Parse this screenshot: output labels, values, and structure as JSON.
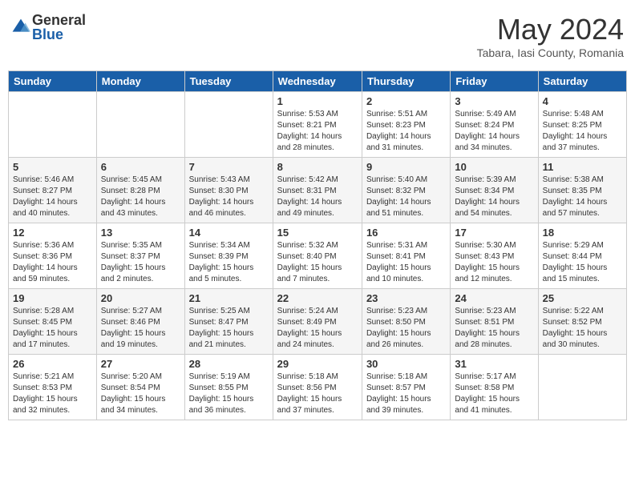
{
  "header": {
    "logo_general": "General",
    "logo_blue": "Blue",
    "month": "May 2024",
    "location": "Tabara, Iasi County, Romania"
  },
  "weekdays": [
    "Sunday",
    "Monday",
    "Tuesday",
    "Wednesday",
    "Thursday",
    "Friday",
    "Saturday"
  ],
  "weeks": [
    [
      {
        "day": "",
        "info": ""
      },
      {
        "day": "",
        "info": ""
      },
      {
        "day": "",
        "info": ""
      },
      {
        "day": "1",
        "info": "Sunrise: 5:53 AM\nSunset: 8:21 PM\nDaylight: 14 hours\nand 28 minutes."
      },
      {
        "day": "2",
        "info": "Sunrise: 5:51 AM\nSunset: 8:23 PM\nDaylight: 14 hours\nand 31 minutes."
      },
      {
        "day": "3",
        "info": "Sunrise: 5:49 AM\nSunset: 8:24 PM\nDaylight: 14 hours\nand 34 minutes."
      },
      {
        "day": "4",
        "info": "Sunrise: 5:48 AM\nSunset: 8:25 PM\nDaylight: 14 hours\nand 37 minutes."
      }
    ],
    [
      {
        "day": "5",
        "info": "Sunrise: 5:46 AM\nSunset: 8:27 PM\nDaylight: 14 hours\nand 40 minutes."
      },
      {
        "day": "6",
        "info": "Sunrise: 5:45 AM\nSunset: 8:28 PM\nDaylight: 14 hours\nand 43 minutes."
      },
      {
        "day": "7",
        "info": "Sunrise: 5:43 AM\nSunset: 8:30 PM\nDaylight: 14 hours\nand 46 minutes."
      },
      {
        "day": "8",
        "info": "Sunrise: 5:42 AM\nSunset: 8:31 PM\nDaylight: 14 hours\nand 49 minutes."
      },
      {
        "day": "9",
        "info": "Sunrise: 5:40 AM\nSunset: 8:32 PM\nDaylight: 14 hours\nand 51 minutes."
      },
      {
        "day": "10",
        "info": "Sunrise: 5:39 AM\nSunset: 8:34 PM\nDaylight: 14 hours\nand 54 minutes."
      },
      {
        "day": "11",
        "info": "Sunrise: 5:38 AM\nSunset: 8:35 PM\nDaylight: 14 hours\nand 57 minutes."
      }
    ],
    [
      {
        "day": "12",
        "info": "Sunrise: 5:36 AM\nSunset: 8:36 PM\nDaylight: 14 hours\nand 59 minutes."
      },
      {
        "day": "13",
        "info": "Sunrise: 5:35 AM\nSunset: 8:37 PM\nDaylight: 15 hours\nand 2 minutes."
      },
      {
        "day": "14",
        "info": "Sunrise: 5:34 AM\nSunset: 8:39 PM\nDaylight: 15 hours\nand 5 minutes."
      },
      {
        "day": "15",
        "info": "Sunrise: 5:32 AM\nSunset: 8:40 PM\nDaylight: 15 hours\nand 7 minutes."
      },
      {
        "day": "16",
        "info": "Sunrise: 5:31 AM\nSunset: 8:41 PM\nDaylight: 15 hours\nand 10 minutes."
      },
      {
        "day": "17",
        "info": "Sunrise: 5:30 AM\nSunset: 8:43 PM\nDaylight: 15 hours\nand 12 minutes."
      },
      {
        "day": "18",
        "info": "Sunrise: 5:29 AM\nSunset: 8:44 PM\nDaylight: 15 hours\nand 15 minutes."
      }
    ],
    [
      {
        "day": "19",
        "info": "Sunrise: 5:28 AM\nSunset: 8:45 PM\nDaylight: 15 hours\nand 17 minutes."
      },
      {
        "day": "20",
        "info": "Sunrise: 5:27 AM\nSunset: 8:46 PM\nDaylight: 15 hours\nand 19 minutes."
      },
      {
        "day": "21",
        "info": "Sunrise: 5:25 AM\nSunset: 8:47 PM\nDaylight: 15 hours\nand 21 minutes."
      },
      {
        "day": "22",
        "info": "Sunrise: 5:24 AM\nSunset: 8:49 PM\nDaylight: 15 hours\nand 24 minutes."
      },
      {
        "day": "23",
        "info": "Sunrise: 5:23 AM\nSunset: 8:50 PM\nDaylight: 15 hours\nand 26 minutes."
      },
      {
        "day": "24",
        "info": "Sunrise: 5:23 AM\nSunset: 8:51 PM\nDaylight: 15 hours\nand 28 minutes."
      },
      {
        "day": "25",
        "info": "Sunrise: 5:22 AM\nSunset: 8:52 PM\nDaylight: 15 hours\nand 30 minutes."
      }
    ],
    [
      {
        "day": "26",
        "info": "Sunrise: 5:21 AM\nSunset: 8:53 PM\nDaylight: 15 hours\nand 32 minutes."
      },
      {
        "day": "27",
        "info": "Sunrise: 5:20 AM\nSunset: 8:54 PM\nDaylight: 15 hours\nand 34 minutes."
      },
      {
        "day": "28",
        "info": "Sunrise: 5:19 AM\nSunset: 8:55 PM\nDaylight: 15 hours\nand 36 minutes."
      },
      {
        "day": "29",
        "info": "Sunrise: 5:18 AM\nSunset: 8:56 PM\nDaylight: 15 hours\nand 37 minutes."
      },
      {
        "day": "30",
        "info": "Sunrise: 5:18 AM\nSunset: 8:57 PM\nDaylight: 15 hours\nand 39 minutes."
      },
      {
        "day": "31",
        "info": "Sunrise: 5:17 AM\nSunset: 8:58 PM\nDaylight: 15 hours\nand 41 minutes."
      },
      {
        "day": "",
        "info": ""
      }
    ]
  ]
}
